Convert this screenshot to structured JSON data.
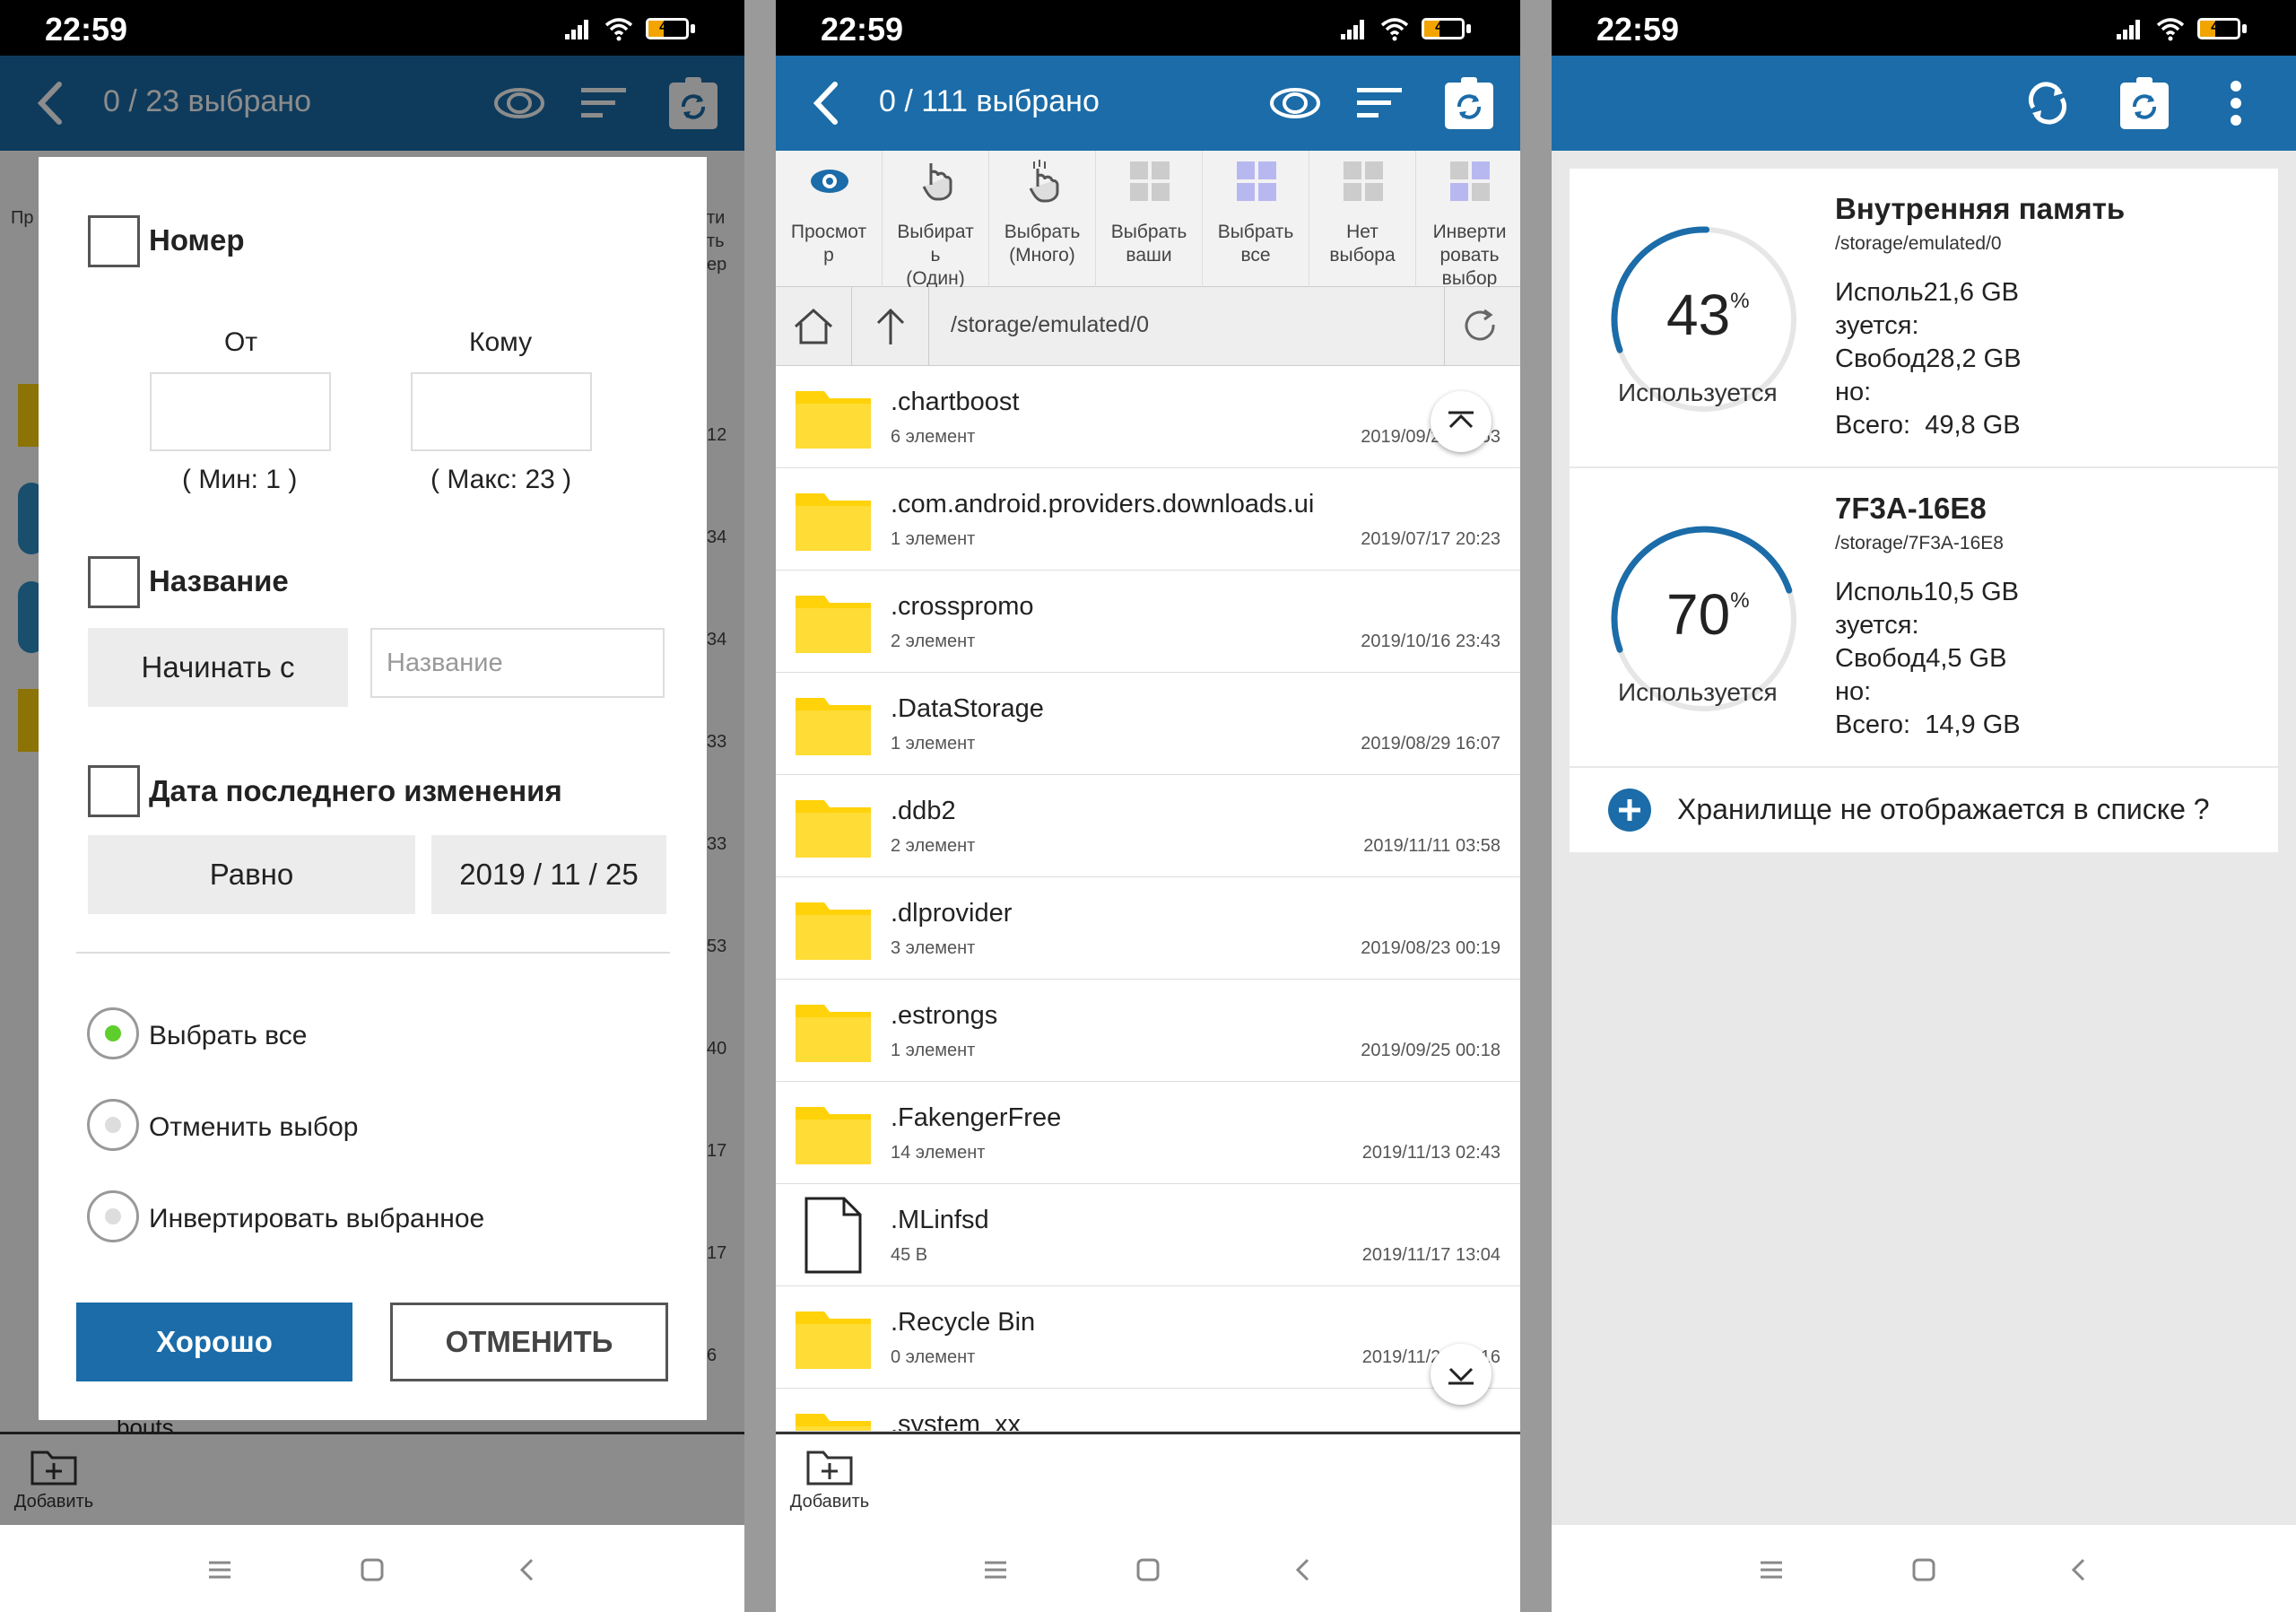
{
  "status": {
    "time": "22:59",
    "battery": "41",
    "battery_level": 0.41
  },
  "colors": {
    "accent": "#1b6ca8",
    "folder": "#ffd20a",
    "radio_on": "#5fce2c"
  },
  "panel1": {
    "appbar_title": "0 / 23 выбрано",
    "bg_labels": [
      "Пр",
      "ти",
      "ть",
      "ер",
      "12",
      "34",
      "34",
      "33",
      "33",
      "53",
      "40",
      "17",
      "17",
      "6"
    ],
    "bg_bottom_label": "bouts",
    "dialog": {
      "number_label": "Номер",
      "from_label": "От",
      "to_label": "Кому",
      "min_label": "( Мин: 1 )",
      "max_label": "( Макс: 23 )",
      "name_label": "Название",
      "starts_with_button": "Начинать с",
      "name_placeholder": "Название",
      "date_label": "Дата последнего изменения",
      "equals_button": "Равно",
      "date_value": "2019 / 11 / 25",
      "radio_options": [
        {
          "label": "Выбрать все",
          "selected": true
        },
        {
          "label": "Отменить выбор",
          "selected": false
        },
        {
          "label": "Инвертировать выбранное",
          "selected": false
        }
      ],
      "ok_button": "Хорошо",
      "cancel_button": "ОТМЕНИТЬ"
    },
    "add_label": "Добавить"
  },
  "panel2": {
    "appbar_title": "0 / 111 выбрано",
    "toolbar": [
      {
        "label": "Просмот\nр",
        "icon": "eye-icon"
      },
      {
        "label": "Выбират\nь\n(Один)",
        "icon": "hand-icon"
      },
      {
        "label": "Выбрать\n(Много)",
        "icon": "hand-multi-icon"
      },
      {
        "label": "Выбрать\nваши",
        "icon": "grid-icon"
      },
      {
        "label": "Выбрать\nвсе",
        "icon": "grid-all-icon"
      },
      {
        "label": "Нет\nвыбора",
        "icon": "grid-none-icon"
      },
      {
        "label": "Инверти\nровать\nвыбор",
        "icon": "grid-invert-icon"
      }
    ],
    "path": "/storage/emulated/0",
    "files": [
      {
        "name": ".chartboost",
        "sub": "6 элемент",
        "date": "2019/09/29 19:53",
        "type": "folder"
      },
      {
        "name": ".com.android.providers.downloads.ui",
        "sub": "1 элемент",
        "date": "2019/07/17 20:23",
        "type": "folder"
      },
      {
        "name": ".crosspromo",
        "sub": "2 элемент",
        "date": "2019/10/16 23:43",
        "type": "folder"
      },
      {
        "name": ".DataStorage",
        "sub": "1 элемент",
        "date": "2019/08/29 16:07",
        "type": "folder"
      },
      {
        "name": ".ddb2",
        "sub": "2 элемент",
        "date": "2019/11/11 03:58",
        "type": "folder"
      },
      {
        "name": ".dlprovider",
        "sub": "3 элемент",
        "date": "2019/08/23 00:19",
        "type": "folder"
      },
      {
        "name": ".estrongs",
        "sub": "1 элемент",
        "date": "2019/09/25 00:18",
        "type": "folder"
      },
      {
        "name": ".FakengerFree",
        "sub": "14 элемент",
        "date": "2019/11/13 02:43",
        "type": "folder"
      },
      {
        "name": ".MLinfsd",
        "sub": "45 B",
        "date": "2019/11/17 13:04",
        "type": "file"
      },
      {
        "name": ".Recycle Bin",
        "sub": "0 элемент",
        "date": "2019/11/23 05:16",
        "type": "folder"
      },
      {
        "name": ".system_xx",
        "sub": "",
        "date": "",
        "type": "folder"
      }
    ],
    "add_label": "Добавить"
  },
  "panel3": {
    "storages": [
      {
        "name": "Внутренняя память",
        "path": "/storage/emulated/0",
        "percent": "43",
        "percent_value": 43,
        "used_caption": "Используется",
        "used_label": "Исполь",
        "used_label2": "зуется:",
        "used_value": "21,6 GB",
        "free_label": "Свобод",
        "free_label2": "но:",
        "free_value": "28,2 GB",
        "total_label": "Всего:",
        "total_value": "49,8 GB"
      },
      {
        "name": "7F3A-16E8",
        "path": "/storage/7F3A-16E8",
        "percent": "70",
        "percent_value": 70,
        "used_caption": "Используется",
        "used_label": "Исполь",
        "used_label2": "зуется:",
        "used_value": "10,5 GB",
        "free_label": "Свобод",
        "free_label2": "но:",
        "free_value": "4,5 GB",
        "total_label": "Всего:",
        "total_value": "14,9 GB"
      }
    ],
    "missing_storage": "Хранилище не отображается в списке ?"
  },
  "percent_symbol": "%"
}
